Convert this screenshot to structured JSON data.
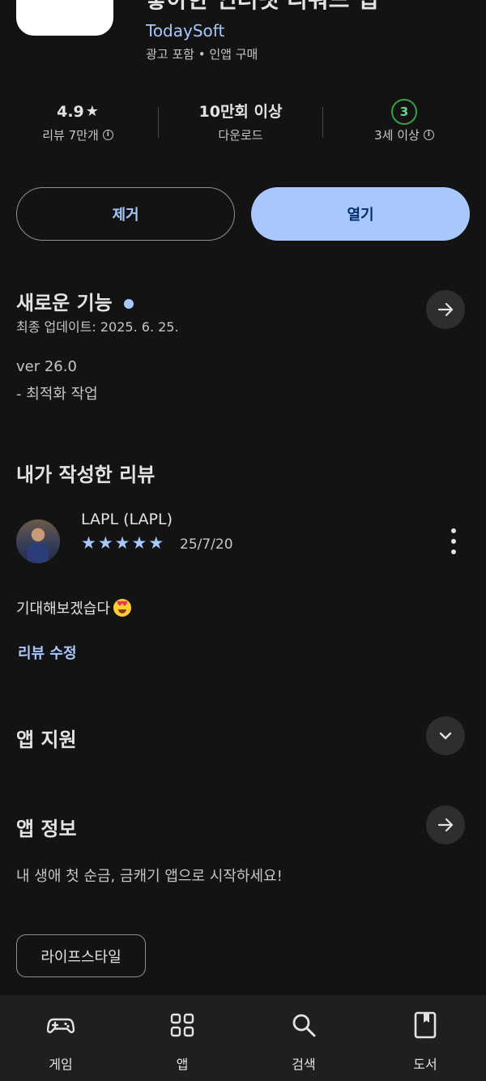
{
  "header": {
    "title": "좋아한 인터넷 리워드 앱",
    "developer": "TodaySoft",
    "meta": "광고 포함 • 인앱 구매"
  },
  "stats": {
    "rating": {
      "value": "4.9",
      "label": "리뷰 7만개"
    },
    "downloads": {
      "value": "10만회 이상",
      "label": "다운로드"
    },
    "content_rating": {
      "value": "3",
      "label": "3세 이상",
      "color": "#37a047"
    }
  },
  "actions": {
    "remove_label": "제거",
    "open_label": "열기"
  },
  "whats_new": {
    "title": "새로운 기능",
    "last_updated": "최종 업데이트: 2025. 6. 25.",
    "version": "ver 26.0",
    "notes": "- 최적화 작업"
  },
  "my_review": {
    "title": "내가 작성한 리뷰",
    "reviewer": "LAPL (LAPL)",
    "stars": 5,
    "date": "25/7/20",
    "text": "기대해보겠습다",
    "edit_label": "리뷰 수정"
  },
  "app_support": {
    "title": "앱 지원"
  },
  "about": {
    "title": "앱 정보",
    "description": "내 생애 첫 순금, 금캐기 앱으로 시작하세요!",
    "category_chip": "라이프스타일"
  },
  "bottom_nav": {
    "items": [
      {
        "label": "게임",
        "icon": "gamepad-icon"
      },
      {
        "label": "앱",
        "icon": "apps-grid-icon"
      },
      {
        "label": "검색",
        "icon": "search-icon"
      },
      {
        "label": "도서",
        "icon": "book-icon"
      }
    ]
  },
  "colors": {
    "accent": "#a8c7fa",
    "background": "#131314",
    "surface": "#2d2e30"
  }
}
